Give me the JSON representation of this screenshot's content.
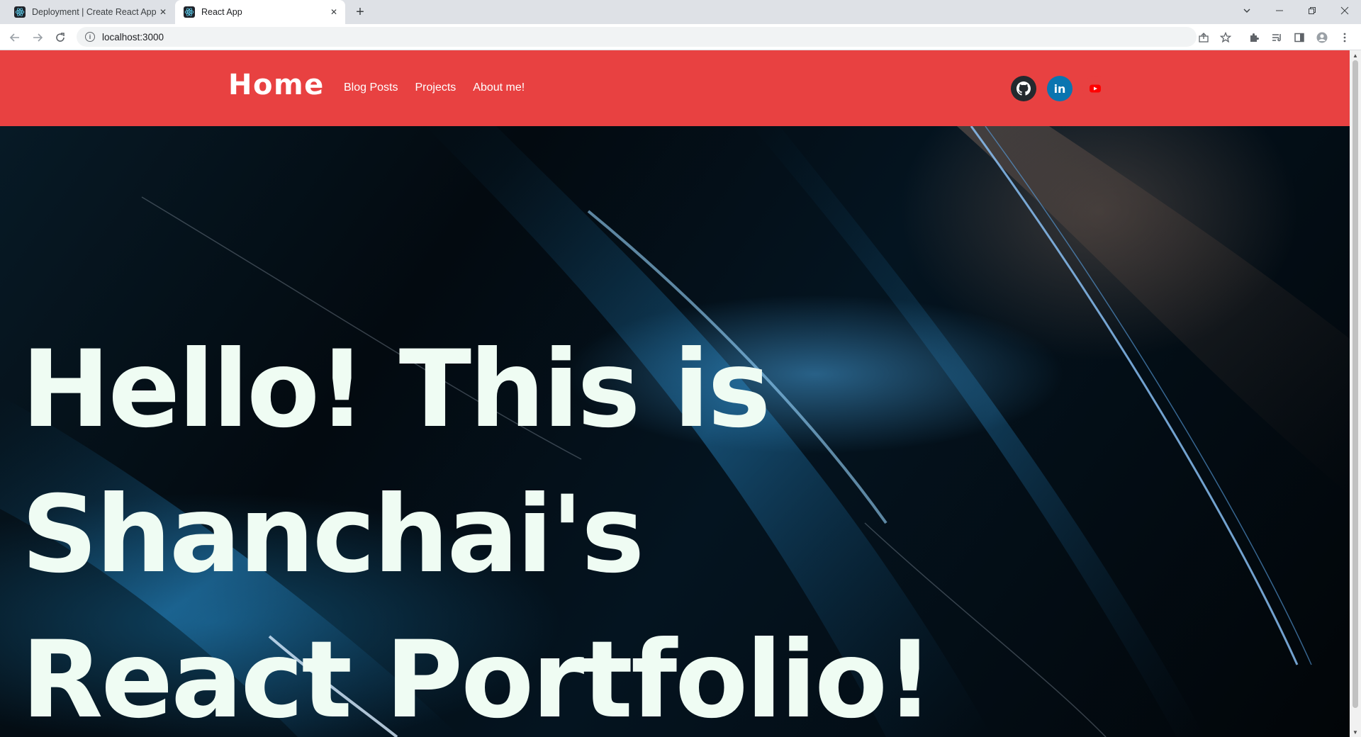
{
  "browser": {
    "tabs": [
      {
        "title": "Deployment | Create React App"
      },
      {
        "title": "React App"
      }
    ],
    "url": "localhost:3000",
    "icons": [
      "back-icon",
      "forward-icon",
      "reload-icon",
      "info-icon",
      "share-icon",
      "star-icon",
      "extensions-icon",
      "reading-list-icon",
      "side-panel-icon",
      "profile-icon",
      "menu-icon"
    ]
  },
  "navbar": {
    "brand": "Home",
    "links": [
      "Blog Posts",
      "Projects",
      "About me!"
    ],
    "social": [
      {
        "name": "github",
        "color": "#24292e"
      },
      {
        "name": "linkedin",
        "label": "in",
        "color": "#0a75b0"
      },
      {
        "name": "youtube",
        "color": "#ff0000"
      }
    ],
    "color": "#e84141"
  },
  "hero": {
    "line1": "Hello! This is Shanchai's",
    "line2": "React Portfolio!",
    "text_color": "#effcf3"
  }
}
